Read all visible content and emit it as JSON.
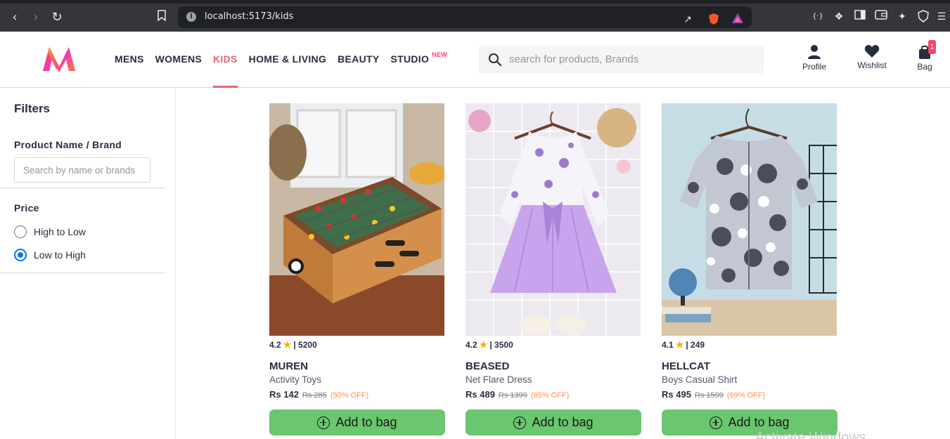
{
  "browser": {
    "url": "localhost:5173/kids"
  },
  "header": {
    "nav": [
      {
        "label": "MENS"
      },
      {
        "label": "WOMENS"
      },
      {
        "label": "KIDS"
      },
      {
        "label": "HOME & LIVING"
      },
      {
        "label": "BEAUTY"
      },
      {
        "label": "STUDIO",
        "badge": "NEW"
      }
    ],
    "active_nav": "KIDS",
    "search_placeholder": "search for products, Brands",
    "actions": {
      "profile": "Profile",
      "wishlist": "Wishlist",
      "bag": "Bag",
      "bag_count": "1"
    },
    "accent_color": "#ee5f73"
  },
  "sidebar": {
    "title": "Filters",
    "name_filter_label": "Product Name / Brand",
    "name_filter_placeholder": "Search by name or brands",
    "name_filter_value": "",
    "price_label": "Price",
    "price_options": [
      {
        "label": "High to Low",
        "checked": false
      },
      {
        "label": "Low to High",
        "checked": true
      }
    ]
  },
  "products": [
    {
      "rating": "4.2",
      "reviews": "5200",
      "brand": "MUREN",
      "name": "Activity Toys",
      "price": "Rs 142",
      "mrp": "Rs 285",
      "discount": "(50% OFF)",
      "button": "Add to bag"
    },
    {
      "rating": "4.2",
      "reviews": "3500",
      "brand": "BEASED",
      "name": "Net Flare Dress",
      "price": "Rs 489",
      "mrp": "Rs 1399",
      "discount": "(65% OFF)",
      "button": "Add to bag"
    },
    {
      "rating": "4.1",
      "reviews": "249",
      "brand": "HELLCAT",
      "name": "Boys Casual Shirt",
      "price": "Rs 495",
      "mrp": "Rs 1599",
      "discount": "(69% OFF)",
      "button": "Add to bag"
    }
  ],
  "watermark": "Activate Windows"
}
